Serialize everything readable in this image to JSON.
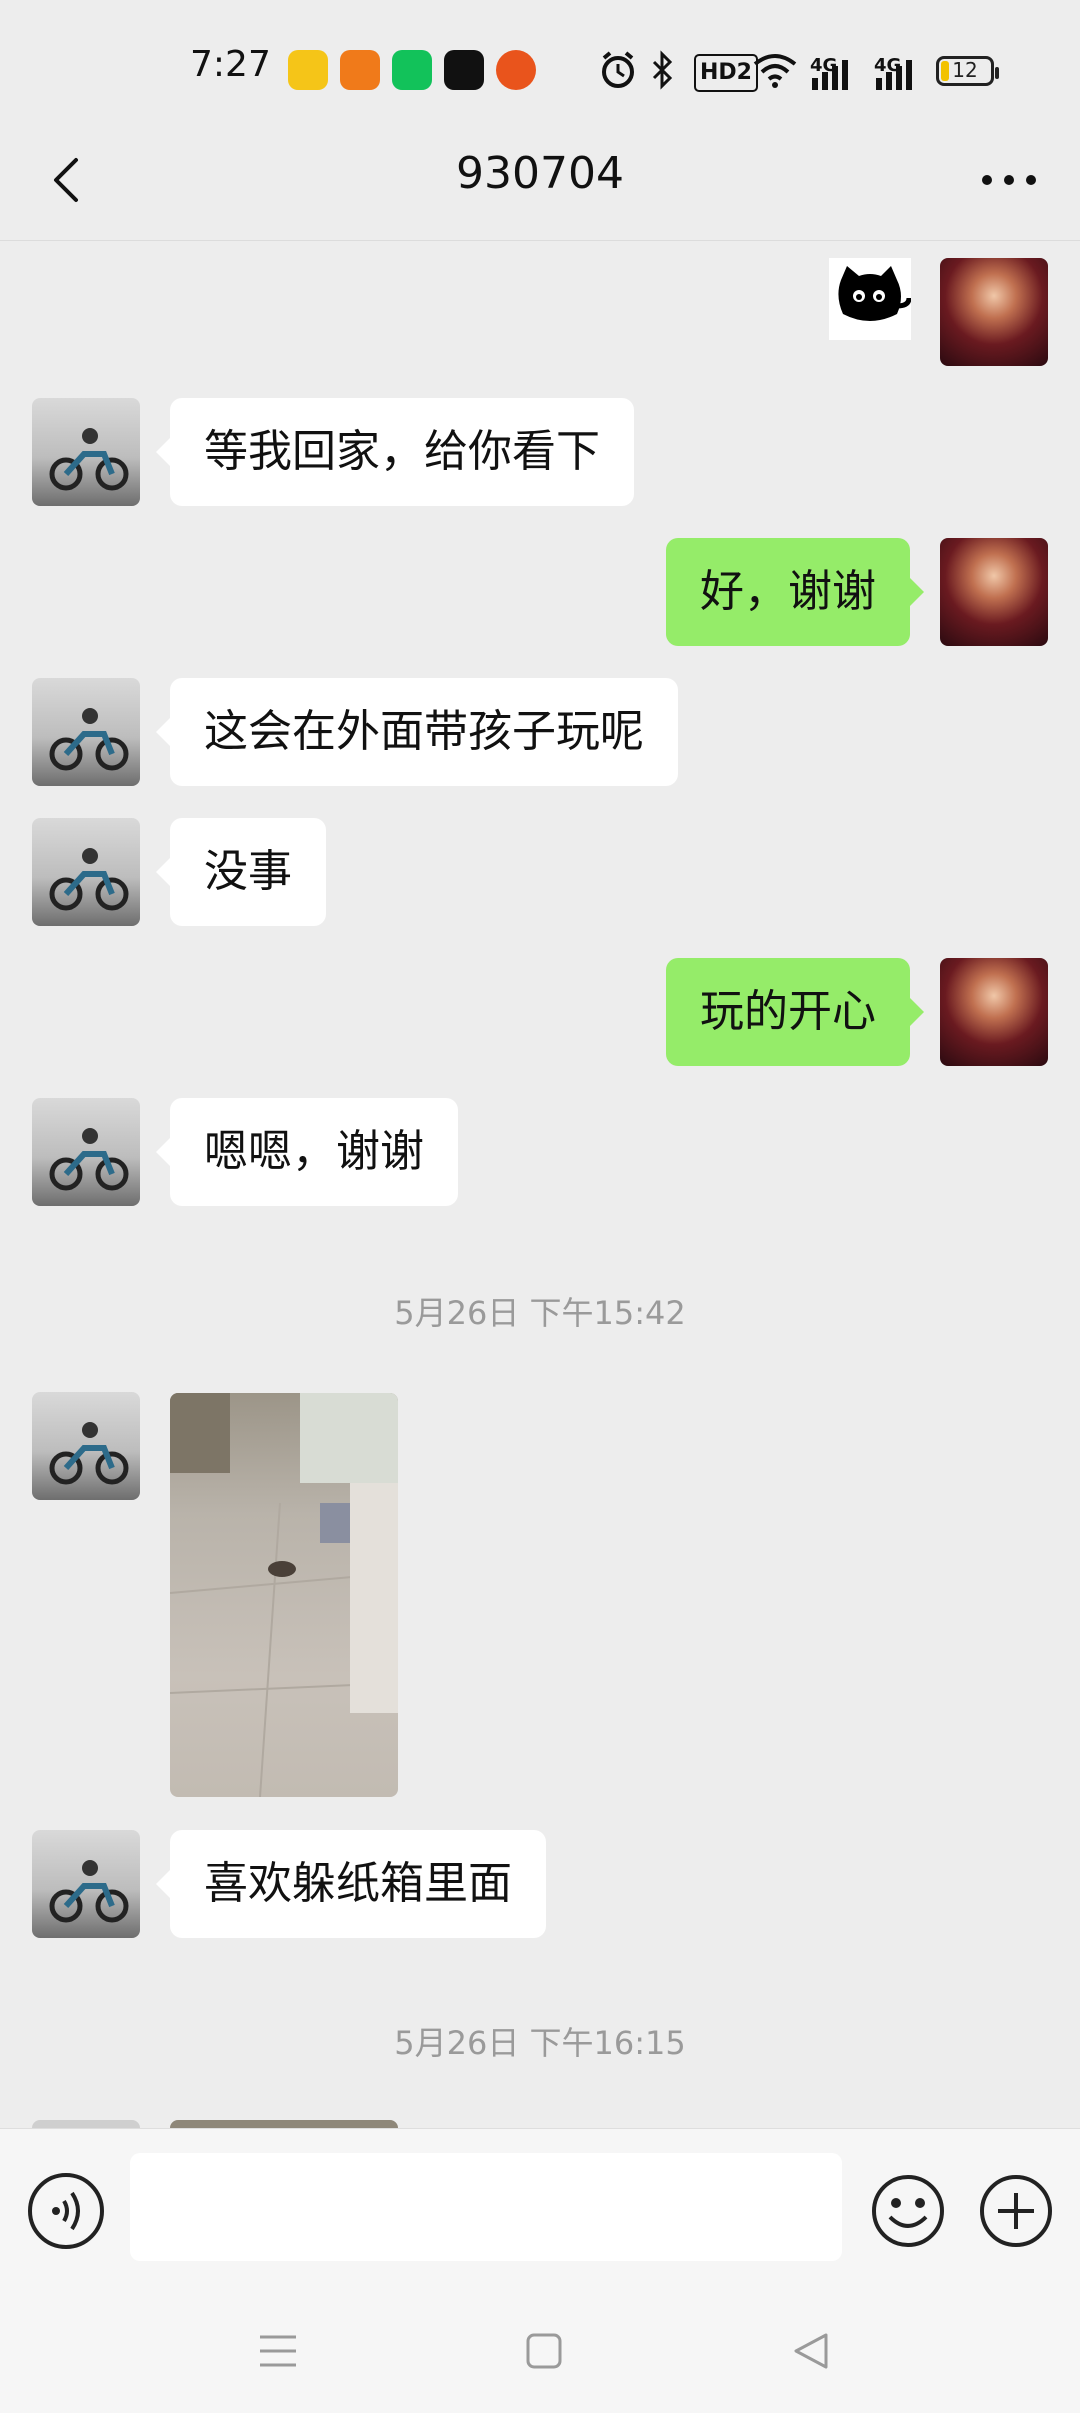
{
  "status_bar": {
    "time": "7:27",
    "network_labels": [
      "HD2",
      "4G",
      "4G"
    ],
    "battery_level": "12",
    "app_icon_colors": [
      "#f5c518",
      "#f07a1a",
      "#12c25a",
      "#111111",
      "#e9541c"
    ]
  },
  "header": {
    "title": "930704",
    "back_icon": "chevron-left-icon",
    "more_icon": "more-dots-icon"
  },
  "messages": [
    {
      "side": "out",
      "type": "sticker",
      "label": "black-cat-sticker"
    },
    {
      "side": "in",
      "text": "等我回家，给你看下"
    },
    {
      "side": "out",
      "text": "好，谢谢"
    },
    {
      "side": "in",
      "text": "这会在外面带孩子玩呢"
    },
    {
      "side": "in",
      "text": "没事"
    },
    {
      "side": "out",
      "text": "玩的开心"
    },
    {
      "side": "in",
      "text": "嗯嗯，谢谢"
    },
    {
      "type": "timestamp",
      "text": "5月26日 下午15:42"
    },
    {
      "side": "in",
      "type": "image",
      "label": "cat-on-floor-photo"
    },
    {
      "side": "in",
      "text": "喜欢躲纸箱里面"
    },
    {
      "type": "timestamp",
      "text": "5月26日 下午16:15"
    }
  ],
  "input_bar": {
    "voice_icon": "voice-input-icon",
    "text_value": "",
    "emoji_icon": "emoji-icon",
    "plus_icon": "plus-icon"
  },
  "nav_bar": [
    "menu-nav-icon",
    "home-nav-icon",
    "back-nav-icon"
  ],
  "colors": {
    "background": "#ededed",
    "bubble_out": "#95ec69",
    "bubble_in": "#ffffff"
  }
}
